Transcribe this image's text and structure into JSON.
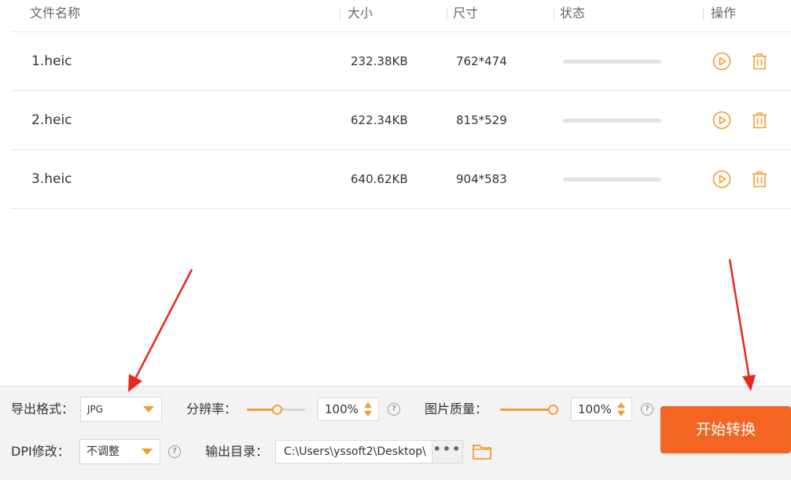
{
  "table": {
    "headers": {
      "name": "文件名称",
      "size": "大小",
      "dimensions": "尺寸",
      "status": "状态",
      "actions": "操作"
    },
    "rows": [
      {
        "name": "1.heic",
        "size": "232.38KB",
        "dimensions": "762*474",
        "progress": 0
      },
      {
        "name": "2.heic",
        "size": "622.34KB",
        "dimensions": "815*529",
        "progress": 0
      },
      {
        "name": "3.heic",
        "size": "640.62KB",
        "dimensions": "904*583",
        "progress": 0
      }
    ]
  },
  "settings": {
    "export_format_label": "导出格式：",
    "export_format_value": "JPG",
    "resolution_label": "分辨率：",
    "resolution_value": "100%",
    "resolution_level": 0.5,
    "quality_label": "图片质量：",
    "quality_value": "100%",
    "quality_level": 1.0,
    "dpi_label": "DPI修改：",
    "dpi_value": "不调整",
    "output_dir_label": "输出目录：",
    "output_dir_value": "C:\\Users\\yssoft2\\Desktop\\",
    "browse_label": "•••",
    "start_button": "开始转换"
  },
  "icons": {
    "play": "play-circle-icon",
    "delete": "trash-icon",
    "help": "help-circle-icon",
    "folder": "folder-icon"
  },
  "colors": {
    "accent": "#f39c2c",
    "primary_button": "#f26522",
    "annotation_arrow": "#e8281e"
  }
}
